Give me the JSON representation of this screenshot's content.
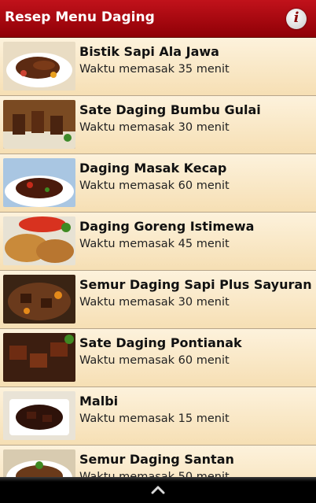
{
  "app": {
    "title": "Resep Menu Daging",
    "info_icon": "info-icon"
  },
  "recipes": [
    {
      "name": "Bistik Sapi Ala Jawa",
      "time": "Waktu memasak 35 menit"
    },
    {
      "name": "Sate Daging Bumbu Gulai",
      "time": "Waktu memasak 30 menit"
    },
    {
      "name": "Daging Masak Kecap",
      "time": "Waktu memasak 60 menit"
    },
    {
      "name": "Daging Goreng Istimewa",
      "time": "Waktu memasak 45 menit"
    },
    {
      "name": "Semur Daging Sapi Plus Sayuran",
      "time": "Waktu memasak 30 menit"
    },
    {
      "name": "Sate Daging Pontianak",
      "time": "Waktu memasak 60 menit"
    },
    {
      "name": "Malbi",
      "time": "Waktu memasak 15 menit"
    },
    {
      "name": "Semur Daging Santan",
      "time": "Waktu memasak 50 menit"
    }
  ],
  "colors": {
    "appbar": "#b0101a",
    "list_background": "#fbe9c5",
    "divider": "#b6a58a"
  },
  "bottom": {
    "icon": "chevron-up-icon"
  }
}
